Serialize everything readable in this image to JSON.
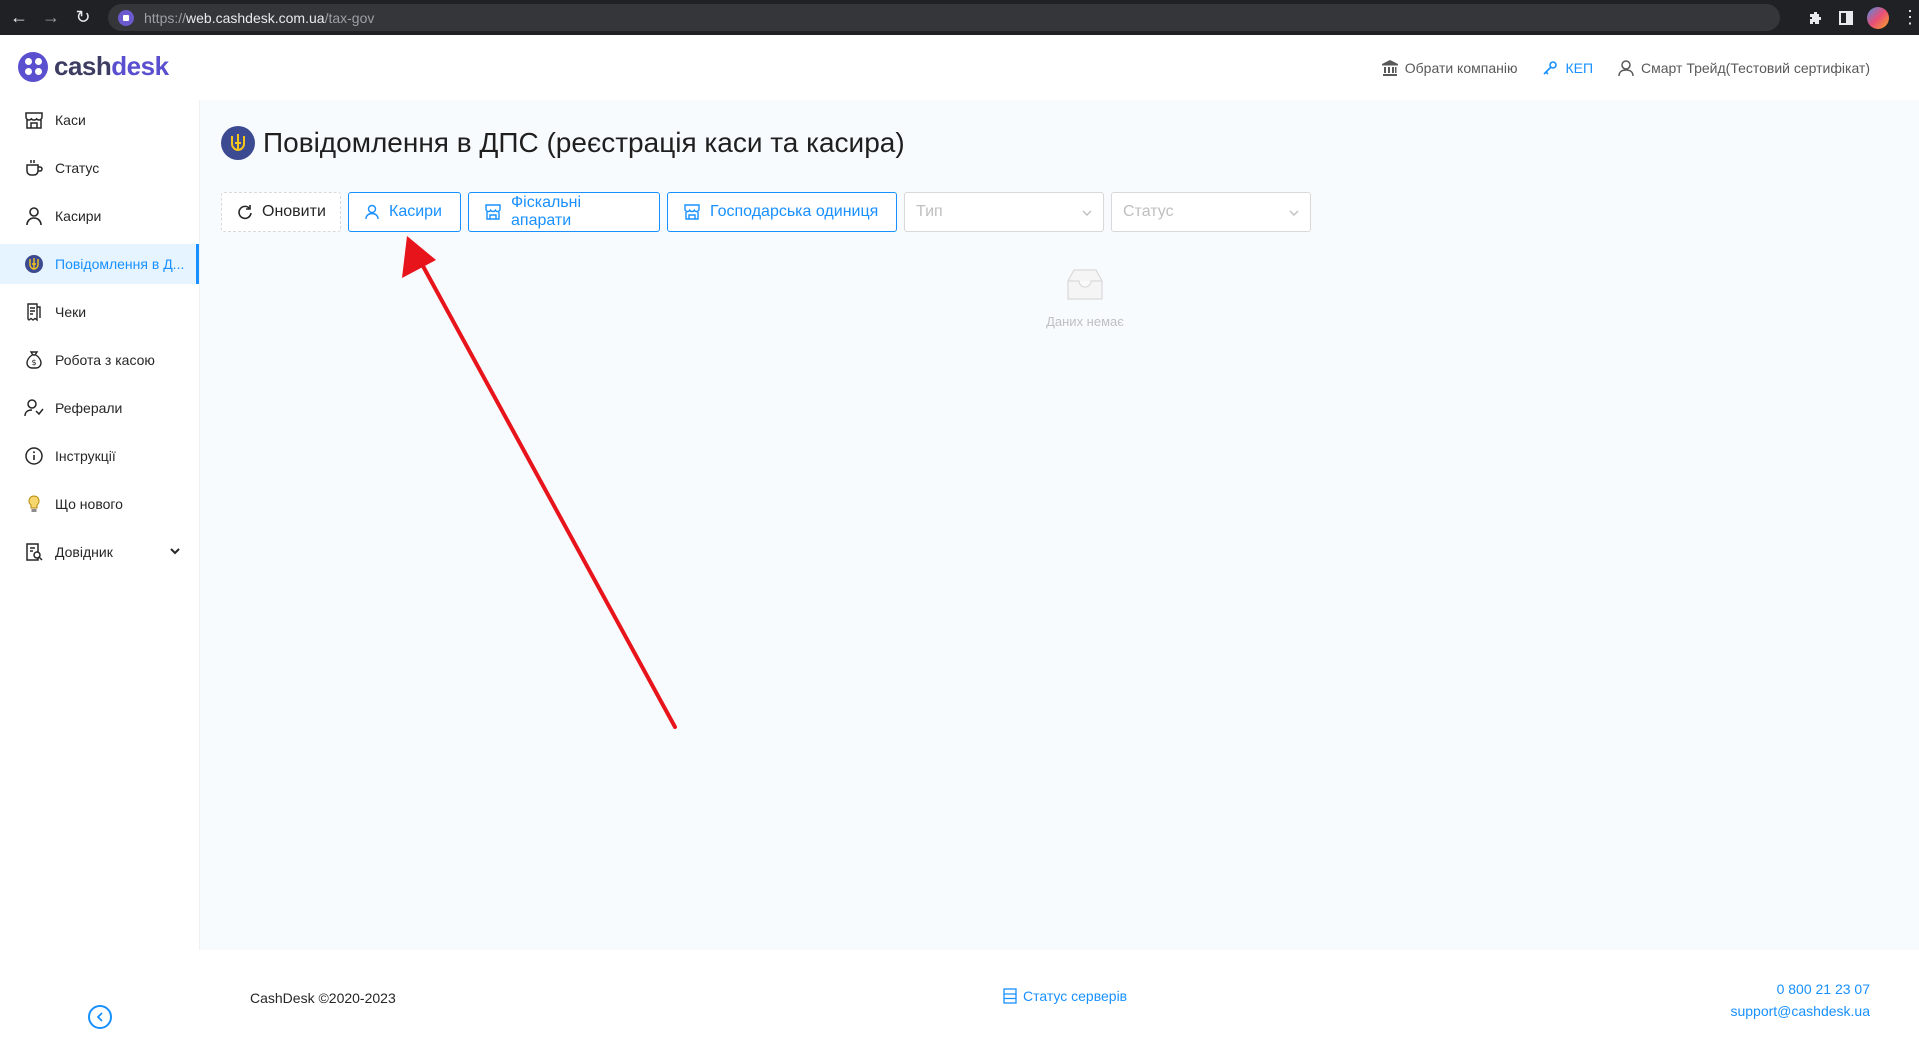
{
  "browser": {
    "url_scheme": "https://",
    "url_host": "web.cashdesk.com.ua",
    "url_path": "/tax-gov"
  },
  "brand": {
    "name_part1": "cash",
    "name_part2": "desk",
    "accent": "#5a4fcf"
  },
  "header": {
    "choose_company": "Обрати компанію",
    "kep": "КЕП",
    "user": "Смарт Трейд(Тестовий сертифікат)"
  },
  "sidebar": {
    "items": [
      {
        "label": "Каси",
        "icon": "store-icon"
      },
      {
        "label": "Статус",
        "icon": "cup-icon"
      },
      {
        "label": "Касири",
        "icon": "user-icon"
      },
      {
        "label": "Повідомлення в Д...",
        "icon": "trident-emblem-icon"
      },
      {
        "label": "Чеки",
        "icon": "receipts-icon"
      },
      {
        "label": "Робота з касою",
        "icon": "money-bag-icon"
      },
      {
        "label": "Реферали",
        "icon": "referrals-icon"
      },
      {
        "label": "Інструкції",
        "icon": "info-icon"
      },
      {
        "label": "Що нового",
        "icon": "lightbulb-icon"
      },
      {
        "label": "Довідник",
        "icon": "reference-book-icon"
      }
    ]
  },
  "page": {
    "title": "Повідомлення в ДПС (реєстрація каси та касира)"
  },
  "toolbar": {
    "refresh_label": "Оновити",
    "cashiers_label": "Касири",
    "fiscal_label": "Фіскальні апарати",
    "business_unit_label": "Господарська одиниця",
    "type_placeholder": "Тип",
    "status_placeholder": "Статус"
  },
  "empty": {
    "text": "Даних немає"
  },
  "footer": {
    "copyright": "CashDesk ©2020-2023",
    "server_status": "Статус серверів",
    "phone": "0 800 21 23 07",
    "email": "support@cashdesk.ua"
  },
  "colors": {
    "primary": "#1890ff",
    "annotation_arrow": "#e8141b",
    "content_bg": "#f8fbfd"
  }
}
